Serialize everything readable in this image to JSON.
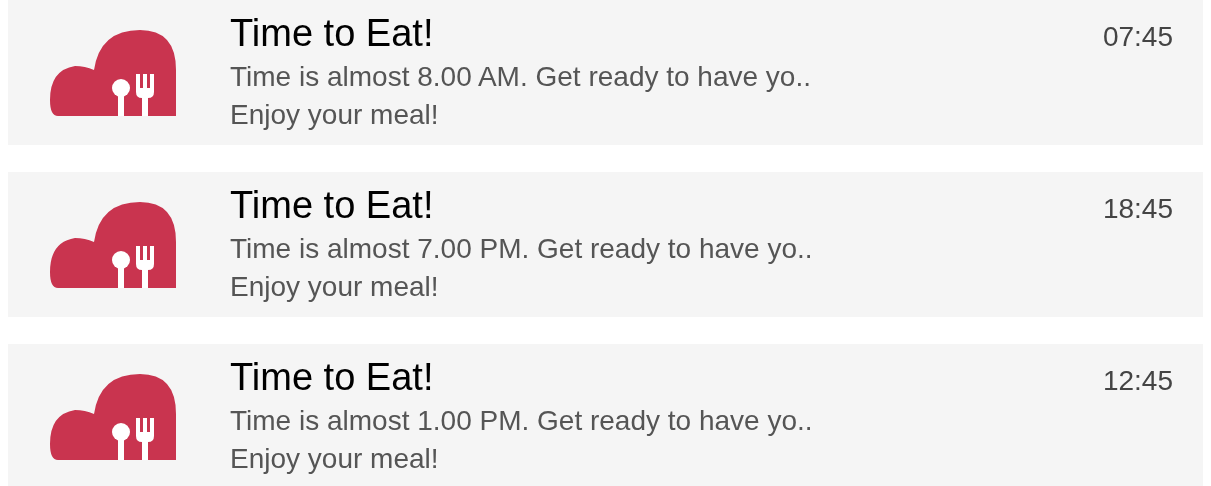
{
  "notifications": [
    {
      "title": "Time to Eat!",
      "time": "07:45",
      "message": "Time is almost 8.00 AM. Get ready to have yo..",
      "detail": "Enjoy your meal!"
    },
    {
      "title": "Time to Eat!",
      "time": "18:45",
      "message": "Time is almost 7.00 PM. Get ready to have yo..",
      "detail": "Enjoy your meal!"
    },
    {
      "title": "Time to Eat!",
      "time": "12:45",
      "message": "Time is almost 1.00 PM. Get ready to have yo..",
      "detail": "Enjoy your meal!"
    }
  ]
}
